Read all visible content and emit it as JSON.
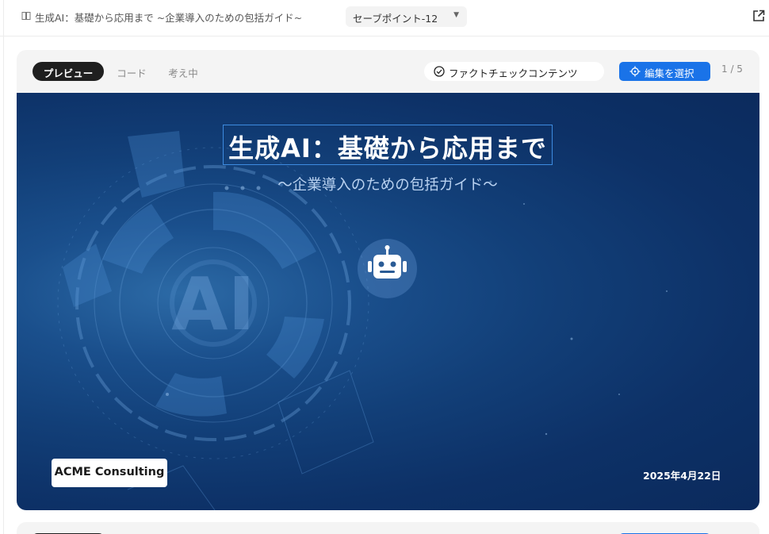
{
  "header": {
    "doc_title": "生成AI：基礎から応用まで ~企業導入のための包括ガイド~",
    "savepoint": "セーブポイント-12",
    "icons": {
      "doc": "book-icon",
      "savepoint": "chevron-down-icon",
      "open": "open-external-icon"
    }
  },
  "card": {
    "tabs": [
      "プレビュー",
      "コード",
      "考え中"
    ],
    "active_tab": "プレビュー",
    "fact_check_label": "ファクトチェックコンテンツ",
    "edit_select_label": "編集を選択",
    "page_indicator": "1 / 5",
    "colors": {
      "accent": "#1a73e8",
      "active_tab": "#1f1f1f"
    }
  },
  "slide": {
    "title": "生成AI：基礎から応用まで",
    "subtitle": "〜企業導入のための包括ガイド〜",
    "logo_text": "ACME Consulting",
    "date": "2025年4月22日",
    "graphic_text": "AI",
    "icons": {
      "center": "robot-icon"
    },
    "colors": {
      "background": "#0d3167",
      "title_border": "#3d8be0"
    }
  }
}
